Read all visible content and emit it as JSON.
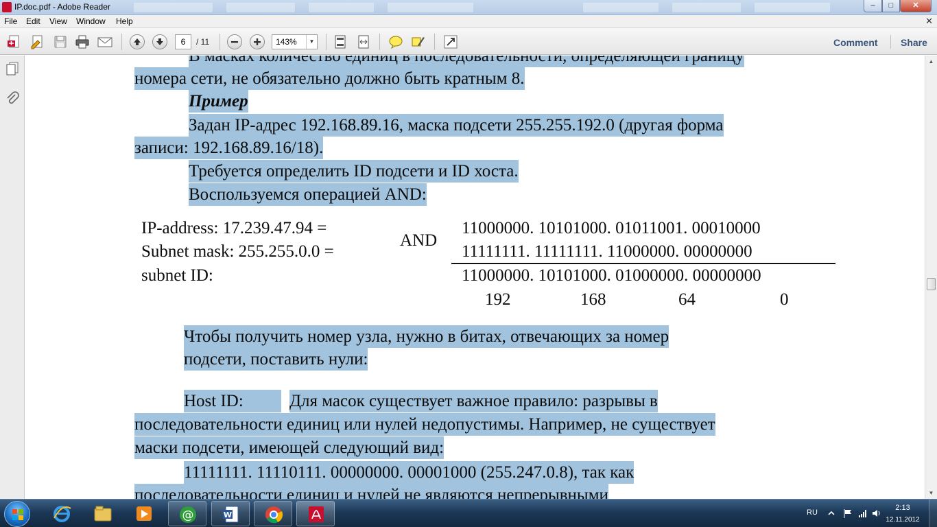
{
  "window": {
    "title": "IP.doc.pdf - Adobe Reader"
  },
  "menu": {
    "items": [
      "File",
      "Edit",
      "View",
      "Window",
      "Help"
    ]
  },
  "toolbar": {
    "page_current": "6",
    "page_total": "/ 11",
    "zoom": "143%",
    "comment_label": "Comment",
    "share_label": "Share"
  },
  "document": {
    "lines": [
      "В масках количество единиц в последовательности, определяющей границу",
      "номера сети, не обязательно должно быть кратным 8.",
      "Пример",
      "Задан IP-адрес 192.168.89.16, маска подсети 255.255.192.0 (другая форма",
      "записи: 192.168.89.16/18).",
      "Требуется определить ID подсети и ID хоста.",
      "Воспользуемся операцией AND:"
    ],
    "and_table": {
      "row1_label": "IP-address: 17.239.47.94 =",
      "row2_label": "Subnet mask: 255.255.0.0 =",
      "row3_label": "subnet ID:",
      "operator": "AND",
      "row1_bits": "11000000. 10101000. 01011001. 00010000",
      "row2_bits": "11111111. 11111111. 11000000. 00000000",
      "row3_bits": "11000000. 10101000. 01000000. 00000000",
      "decimals": [
        "192",
        "168",
        "64",
        "0"
      ]
    },
    "para2_line1": "Чтобы получить номер узла, нужно в битах, отвечающих за номер",
    "para2_line2": "подсети, поставить нули:",
    "host_id_label": "Host ID:",
    "para3_line1": "Для масок существует важное правило: разрывы в",
    "para3_line2": "последовательности единиц или нулей недопустимы. Например, не существует",
    "para3_line3": "маски подсети, имеющей следующий вид:",
    "para4_line1": "11111111. 11110111. 00000000. 00001000 (255.247.0.8), так как",
    "para4_line2": "последовательности единиц и нулей не являются непрерывными"
  },
  "taskbar": {
    "language": "RU",
    "time": "2:13",
    "date": "12.11.2012"
  },
  "colors": {
    "highlight": "#a1c3de",
    "reader_red": "#c8102e",
    "taskbar": "#1c3857"
  }
}
